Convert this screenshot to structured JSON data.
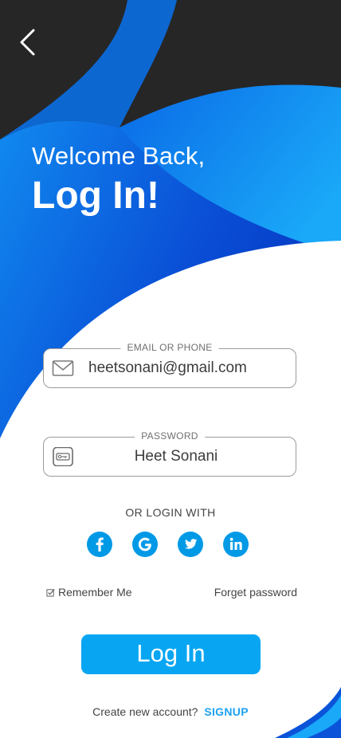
{
  "header": {
    "welcome_text": "Welcome Back,",
    "title": "Log In!"
  },
  "back_icon": "chevron-left-icon",
  "email_field": {
    "label": "EMAIL OR PHONE",
    "value": "heetsonani@gmail.com",
    "icon": "mail-icon"
  },
  "password_field": {
    "label": "PASSWORD",
    "value": "Heet Sonani",
    "icon": "password-icon"
  },
  "social": {
    "label": "OR LOGIN WITH",
    "providers": [
      "facebook-icon",
      "google-icon",
      "twitter-icon",
      "linkedin-icon"
    ]
  },
  "options": {
    "remember_label": "Remember Me",
    "forget_label": "Forget password"
  },
  "login_button_label": "Log In",
  "signup": {
    "prompt": "Create new account?",
    "link_label": "SIGNUP"
  },
  "colors": {
    "accent": "#08a6f2",
    "dark": "#262626",
    "deep_blue": "#0a3fcf",
    "link": "#1da1f2"
  }
}
